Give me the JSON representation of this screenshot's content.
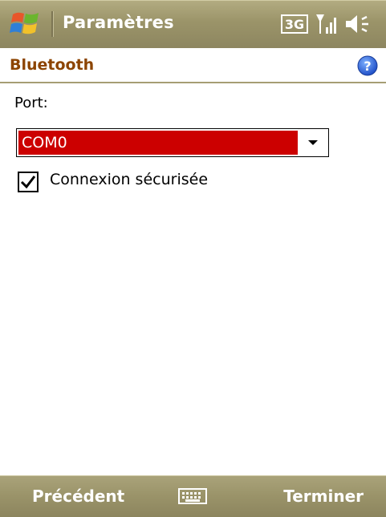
{
  "titlebar": {
    "title": "Paramètres",
    "network_label": "3G",
    "icons": [
      "windows-start-icon",
      "3g-icon",
      "signal-icon",
      "speaker-icon"
    ]
  },
  "section": {
    "title": "Bluetooth",
    "help_icon": "help-icon"
  },
  "form": {
    "port_label": "Port:",
    "port_value": "COM0",
    "secure_checked": true,
    "secure_label": "Connexion sécurisée"
  },
  "softkeys": {
    "left": "Précédent",
    "right": "Terminer",
    "center_icon": "keyboard-icon"
  },
  "colors": {
    "bar": "#9b9469",
    "section_title": "#8c4400",
    "selected": "#cc0000"
  }
}
